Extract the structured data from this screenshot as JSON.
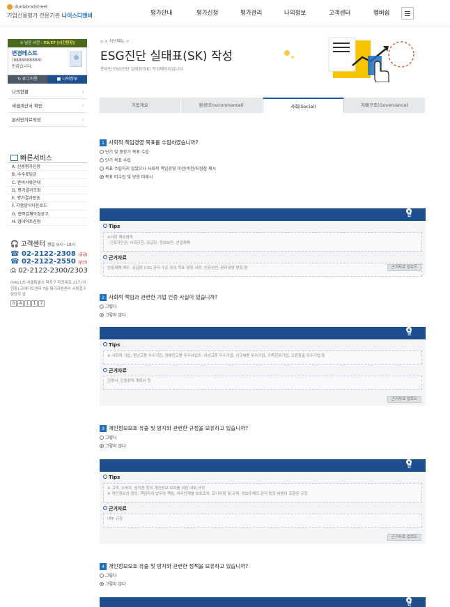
{
  "header": {
    "logo_small": "dun&bradstreet",
    "logo_prefix": "기업신용평가 전문기관",
    "logo_brand": "나이스디앤비",
    "nav": [
      "평가안내",
      "평가신청",
      "평가관리",
      "나의정보",
      "고객센터",
      "멤버쉽"
    ]
  },
  "sidebar": {
    "timer_label": "남은 시간 :",
    "timer_value": "59:57 [시간연장]",
    "user_name": "변경테스트",
    "user_id": "(8888888888)",
    "greeting": "반갑습니다.",
    "logout": "로그아웃",
    "myinfo": "나의정보",
    "menu": [
      "나의현황",
      "세금계산서 확인",
      "온라인자료작성"
    ],
    "quick_title": "빠른서비스",
    "quick": [
      "A. 신용평가신청",
      "B. 수수료입금",
      "C. 준비서류안내",
      "D. 평가결과조회",
      "E. 평가결과전송",
      "F. 각종양식다운로드",
      "G. 협력업체모집공고",
      "H. 업데이트신청"
    ],
    "cs_title": "고객센터",
    "cs_hours": "평일 9시~18시",
    "phone1": "02-2122-2308",
    "phone1_tag": "(공공)",
    "phone2": "02-2122-2550",
    "phone2_tag": "(민간)",
    "fax": "02-2122-2300/2303",
    "address": "(04117) 서울특별시 마포구 마포대로 217 (아현동) 크레디트센터 7층 평가지원센터 서류접수담당자 앞",
    "counter": [
      "0",
      "4",
      "1",
      "1",
      "7"
    ]
  },
  "page": {
    "breadcrumb": "서브메뉴",
    "breadcrumb_sep": ">",
    "title": "ESG진단 실태표(SK) 작성",
    "desc": "온라인 ESG진단 실태표(SK) 작성페이지입니다."
  },
  "tabs": [
    "기업개요",
    "환경(Environmental)",
    "사회(Social)",
    "지배구조(Governance)"
  ],
  "active_tab": 2,
  "close_label": "닫기",
  "tips_label": "Tips",
  "basis_label": "근거자료",
  "more_label": "근거자료 업로드",
  "questions": [
    {
      "num": "1",
      "text": "사회적 책임경영 목표를 수립하였습니까?",
      "options": [
        "단기 및 중장기 목표 수립",
        "단기 목표 수립",
        "목표 수립하지 않았으나 사회적 책임경영 미션/비전/지향점 제시",
        "목표 미수립 및 방향 미제시"
      ],
      "selected": 3,
      "tips": [
        "※사회 핵심영역",
        ": 근로자인권, 사회공헌, 공급망, 정보보안, 산업재해"
      ],
      "basis": "산업재해 예우, 공급망 CSG 관리 수준 등의 목표 명칭 서류, 인권선언, 윤리경영 방침 등"
    },
    {
      "num": "2",
      "text": "사회적 책임과 관련한 기업 인증 사실이 있습니까?",
      "options": [
        "그렇다",
        "그렇지 않다"
      ],
      "selected": 1,
      "tips": [
        "※ 사회적 기업, 청년고용 우수기업, 장애인고용 우수사업주, 여성고용 우수기업, 신규채용 우수기업, 가족친화기업, 고용창출 우수기업 등"
      ],
      "basis": "인증서, 인증취득 계획서 등"
    },
    {
      "num": "3",
      "text": "개인정보보호 유출 및 방지와 관련한 규정을 보유하고 있습니까?",
      "options": [
        "그렇다",
        "그렇지 않다"
      ],
      "selected": 1,
      "tips": [
        "※ 고객, 소비자, 임직원 등의 개인정보 보호를 위한 내부 규정",
        "※ 개인정보의 정의, 책임자의 업무와 책임, 처리단계별 보호조치, 모니터링 및 교육, 정보주체의 권리 등의 내용이 포함된 규정"
      ],
      "basis": "내부 규정"
    },
    {
      "num": "4",
      "text": "개인정보보호 유출 및 방지와 관련한 정책을 보유하고 있습니까?",
      "options": [
        "그렇다",
        "그렇지 않다"
      ],
      "selected": 1
    }
  ]
}
